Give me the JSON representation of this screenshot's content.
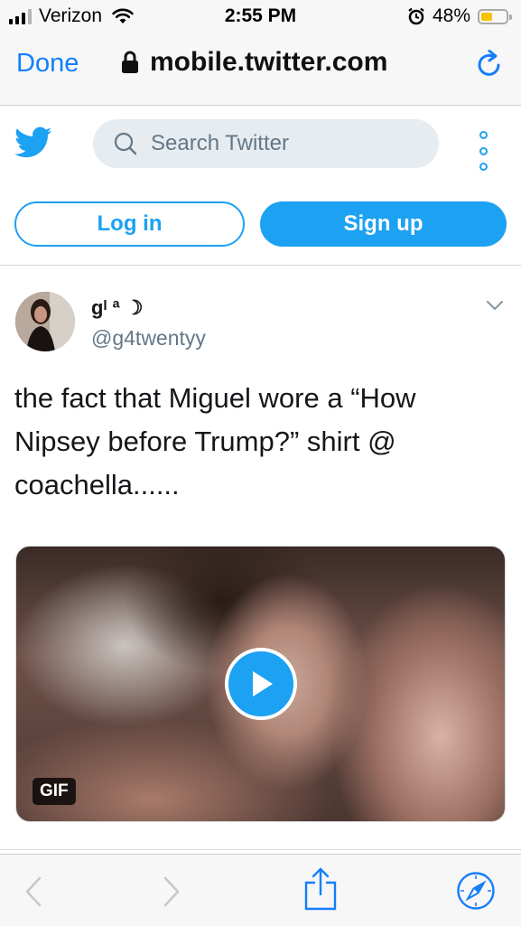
{
  "status_bar": {
    "carrier": "Verizon",
    "time": "2:55 PM",
    "battery_pct": "48%",
    "battery_level": 0.48,
    "icons": [
      "signal-icon",
      "wifi-icon",
      "alarm-icon",
      "battery-icon"
    ]
  },
  "browser": {
    "done_label": "Done",
    "url": "mobile.twitter.com",
    "icons": [
      "lock-icon",
      "reload-icon"
    ]
  },
  "twitter": {
    "search_placeholder": "Search Twitter",
    "login_label": "Log in",
    "signup_label": "Sign up",
    "brand_color": "#1da1f2"
  },
  "tweet": {
    "display_name": "gᴵ ª ☽",
    "handle": "@g4twentyy",
    "text": "the fact that Miguel wore a “How Nipsey before Trump?” shirt @ coachella......",
    "media_badge": "GIF"
  },
  "toolbar": {
    "icons": [
      "back-icon",
      "forward-icon",
      "share-icon",
      "compass-icon"
    ]
  }
}
